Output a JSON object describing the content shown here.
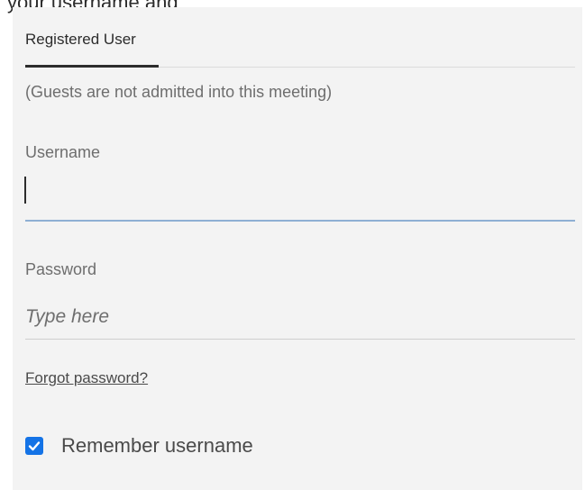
{
  "header_fragment": "your username and",
  "tabs": [
    {
      "label": "Registered User",
      "active": true
    }
  ],
  "notice": "(Guests are not admitted into this meeting)",
  "form": {
    "username_label": "Username",
    "username_value": "",
    "password_label": "Password",
    "password_placeholder": "Type here",
    "forgot_password": "Forgot password?",
    "remember_label": "Remember username",
    "remember_checked": true
  },
  "colors": {
    "accent": "#1473e6",
    "focus_underline": "#8fafd3",
    "panel_background": "#f3f3f3"
  }
}
